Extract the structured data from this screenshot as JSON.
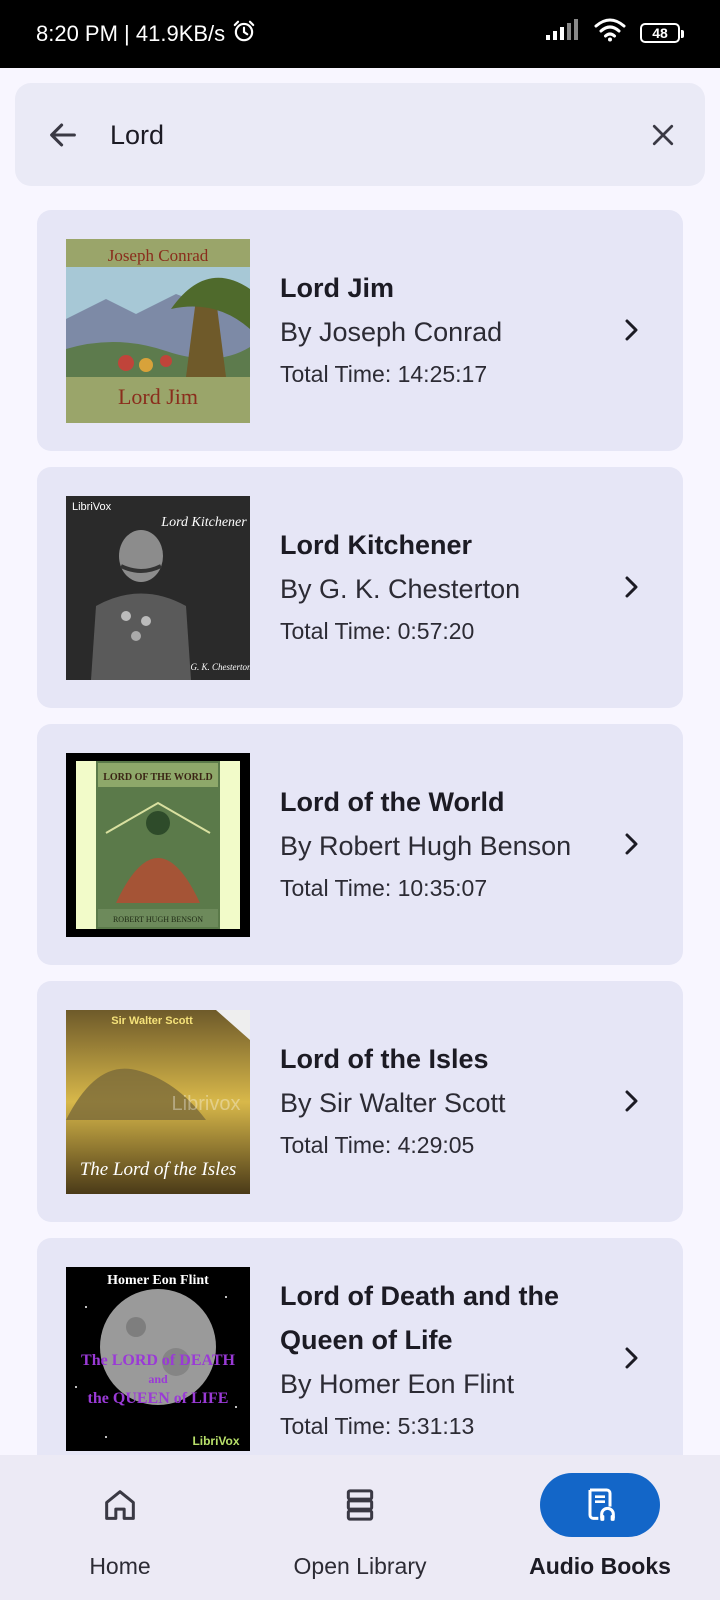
{
  "status_bar": {
    "time_speed": "8:20 PM | 41.9KB/s",
    "battery": "48"
  },
  "search": {
    "query": "Lord",
    "back_icon": "arrow-left-icon",
    "clear_icon": "close-icon"
  },
  "results": [
    {
      "title": "Lord Jim",
      "author": "By Joseph Conrad",
      "time": "Total Time: 14:25:17",
      "cover": {
        "top_text": "Joseph Conrad",
        "bottom_text": "Lord Jim"
      }
    },
    {
      "title": "Lord Kitchener",
      "author": "By G. K. Chesterton",
      "time": "Total Time: 0:57:20",
      "cover": {
        "brand": "LibriVox",
        "top_text": "Lord Kitchener",
        "bottom_text": "G. K. Chesterton"
      }
    },
    {
      "title": "Lord of the World",
      "author": "By Robert Hugh Benson",
      "time": "Total Time: 10:35:07",
      "cover": {
        "top_text": "LORD OF THE WORLD",
        "bottom_text": "ROBERT HUGH BENSON"
      }
    },
    {
      "title": "Lord of the Isles",
      "author": "By Sir Walter Scott",
      "time": "Total Time: 4:29:05",
      "cover": {
        "top_text": "Sir Walter Scott",
        "watermark": "Librivox",
        "bottom_text": "The Lord of the Isles"
      }
    },
    {
      "title": "Lord of Death and the Queen of Life",
      "author": "By Homer Eon Flint",
      "time": "Total Time: 5:31:13",
      "cover": {
        "top_text": "Homer Eon Flint",
        "line1": "The LORD of DEATH",
        "line2": "and",
        "line3": "the QUEEN of LIFE",
        "brand": "LibriVox"
      }
    }
  ],
  "nav": {
    "items": [
      {
        "label": "Home",
        "icon": "home-icon",
        "active": false
      },
      {
        "label": "Open Library",
        "icon": "library-stack-icon",
        "active": false
      },
      {
        "label": "Audio Books",
        "icon": "audiobook-icon",
        "active": true
      }
    ]
  },
  "colors": {
    "accent": "#1366c8",
    "card_bg": "#e6e6f6",
    "page_bg": "#f8f6ff"
  }
}
